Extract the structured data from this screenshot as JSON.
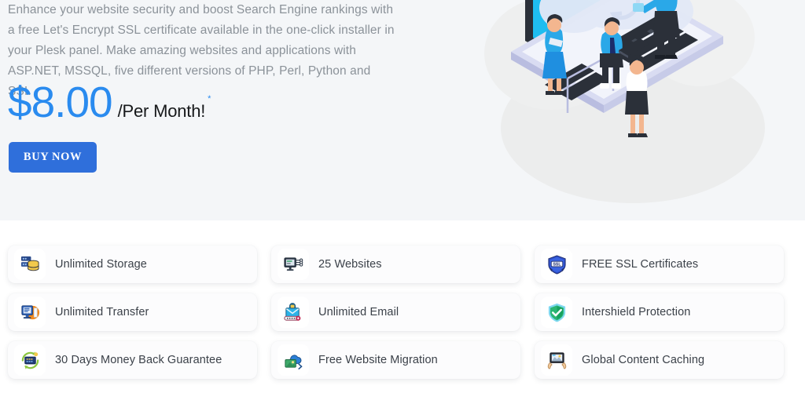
{
  "hero": {
    "description": "Enhance your website security and boost Search Engine rankings with a free Let's Encrypt SSL certificate available in the one-click installer in your Plesk panel. Make amazing websites and applications with ASP.NET, MSSQL, five different versions of PHP, Perl, Python and SSI.",
    "price_amount": "$8.00",
    "price_period": "/Per Month!",
    "price_asterisk": "*",
    "buy_label": "BUY NOW",
    "illustration_name": "isometric-laptop-cloud-team-illustration",
    "background_color": "#f4f6f8",
    "price_color": "#2a8bef",
    "button_color": "#2f6fdb"
  },
  "features": [
    {
      "label": "Unlimited Storage",
      "icon": "database-server-icon"
    },
    {
      "label": "25 Websites",
      "icon": "monitor-network-icon"
    },
    {
      "label": "FREE SSL Certificates",
      "icon": "ssl-shield-icon"
    },
    {
      "label": "Unlimited Transfer",
      "icon": "data-transfer-monitor-icon"
    },
    {
      "label": "Unlimited Email",
      "icon": "secure-email-icon"
    },
    {
      "label": "Intershield Protection",
      "icon": "green-shield-check-icon"
    },
    {
      "label": "30 Days Money Back Guarantee",
      "icon": "money-back-refresh-icon"
    },
    {
      "label": "Free Website Migration",
      "icon": "cloud-migration-icon"
    },
    {
      "label": "Global Content Caching",
      "icon": "hands-holding-screen-icon"
    }
  ]
}
